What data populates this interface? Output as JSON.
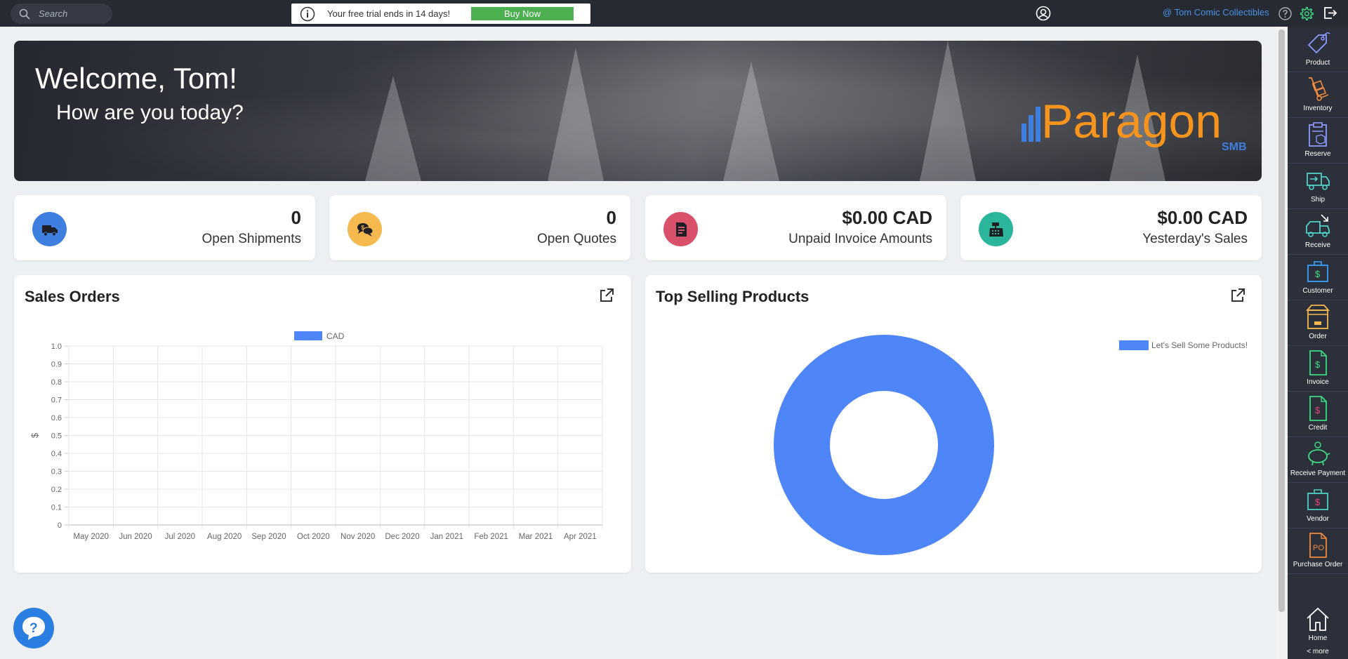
{
  "topbar": {
    "search_placeholder": "Search",
    "trial_text": "Your free trial ends in 14 days!",
    "buy_label": "Buy Now",
    "company": "@ Tom Comic Collectibles"
  },
  "banner": {
    "welcome": "Welcome, Tom!",
    "subtitle": "How are you today?",
    "logo_text": "Paragon",
    "logo_sub": "SMB"
  },
  "cards": [
    {
      "value": "0",
      "label": "Open Shipments",
      "icon": "truck-icon",
      "color": "#3f7fe0"
    },
    {
      "value": "0",
      "label": "Open Quotes",
      "icon": "quote-bubbles-icon",
      "color": "#f5b94f"
    },
    {
      "value": "$0.00 CAD",
      "label": "Unpaid Invoice Amounts",
      "icon": "invoice-icon",
      "color": "#d9506a"
    },
    {
      "value": "$0.00 CAD",
      "label": "Yesterday's Sales",
      "icon": "cash-register-icon",
      "color": "#2bb59a"
    }
  ],
  "sales_orders": {
    "title": "Sales Orders"
  },
  "top_products": {
    "title": "Top Selling Products"
  },
  "chart_data": [
    {
      "type": "bar",
      "title": "",
      "legend": [
        "CAD"
      ],
      "legend_position": "top",
      "ylabel": "$",
      "xlabel": "",
      "categories": [
        "May 2020",
        "Jun 2020",
        "Jul 2020",
        "Aug 2020",
        "Sep 2020",
        "Oct 2020",
        "Nov 2020",
        "Dec 2020",
        "Jan 2021",
        "Feb 2021",
        "Mar 2021",
        "Apr 2021"
      ],
      "series": [
        {
          "name": "CAD",
          "values": [
            0,
            0,
            0,
            0,
            0,
            0,
            0,
            0,
            0,
            0,
            0,
            0
          ]
        }
      ],
      "ylim": [
        0,
        1.0
      ],
      "yticks": [
        "0",
        "0.1",
        "0.2",
        "0.3",
        "0.4",
        "0.5",
        "0.6",
        "0.7",
        "0.8",
        "0.9",
        "1.0"
      ],
      "grid": true,
      "color": "#4f86f7"
    },
    {
      "type": "pie",
      "title": "",
      "labels": [
        "Let's Sell Some Products!"
      ],
      "values": [
        1
      ],
      "legend_position": "top-right",
      "donut": true,
      "color": "#4f86f7"
    }
  ],
  "sidebar": {
    "items": [
      {
        "label": "Product",
        "icon": "product-tag-icon",
        "color": "#8e9aff"
      },
      {
        "label": "Inventory",
        "icon": "hand-truck-icon",
        "color": "#f08a3c"
      },
      {
        "label": "Reserve",
        "icon": "clipboard-box-icon",
        "color": "#8e9aff"
      },
      {
        "label": "Ship",
        "icon": "ship-truck-icon",
        "color": "#4fd1c5"
      },
      {
        "label": "Receive",
        "icon": "receive-truck-icon",
        "color": "#4fd1c5"
      },
      {
        "label": "Customer",
        "icon": "customer-briefcase-icon",
        "color": "#3aa0ff"
      },
      {
        "label": "Order",
        "icon": "order-store-icon",
        "color": "#f5b94f"
      },
      {
        "label": "Invoice",
        "icon": "invoice-doc-icon",
        "color": "#3ddc84"
      },
      {
        "label": "Credit",
        "icon": "credit-doc-icon",
        "color": "#3ddc84"
      },
      {
        "label": "Receive Payment",
        "icon": "piggy-bank-icon",
        "color": "#3ddc84"
      },
      {
        "label": "Vendor",
        "icon": "vendor-briefcase-icon",
        "color": "#4fd1c5"
      },
      {
        "label": "Purchase Order",
        "icon": "po-doc-icon",
        "color": "#f08a3c"
      }
    ],
    "home": "Home",
    "more": "< more"
  }
}
